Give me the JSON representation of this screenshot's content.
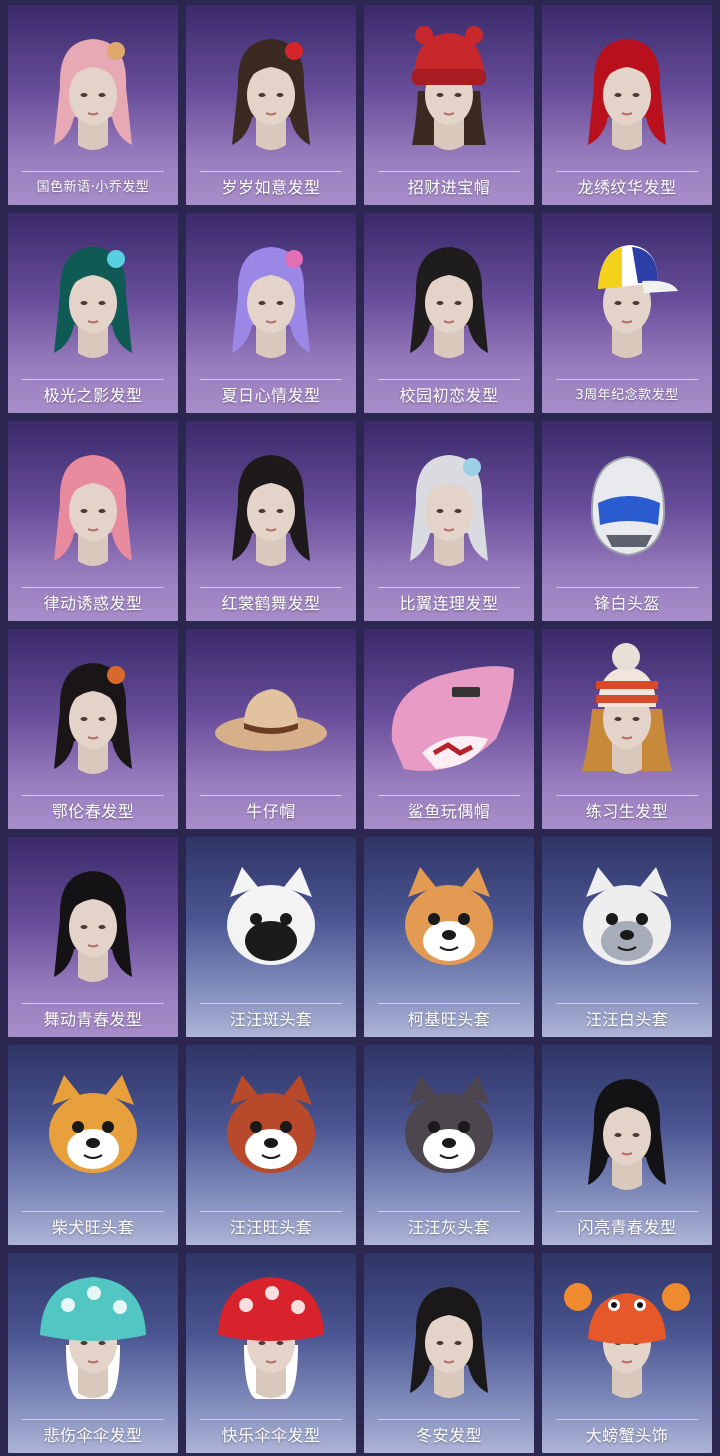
{
  "items": [
    {
      "label": "国色新语·小乔发型",
      "bg": "purple",
      "icon": "pink-braided-hair-icon",
      "kind": "hair",
      "hair": "#e7a9b3",
      "accent": "#e0a86a"
    },
    {
      "label": "岁岁如意发型",
      "bg": "purple",
      "icon": "twin-tail-hair-icon",
      "kind": "hair",
      "hair": "#3a2a22",
      "accent": "#d2262b"
    },
    {
      "label": "招财进宝帽",
      "bg": "purple",
      "icon": "red-knit-hat-icon",
      "kind": "hat",
      "hair": "#3a2a22",
      "accent": "#c8272b"
    },
    {
      "label": "龙绣纹华发型",
      "bg": "purple",
      "icon": "red-bob-hair-icon",
      "kind": "hair",
      "hair": "#b8101c",
      "accent": "#b8101c"
    },
    {
      "label": "极光之影发型",
      "bg": "purple",
      "icon": "teal-twin-tail-hair-icon",
      "kind": "hair",
      "hair": "#0f5a55",
      "accent": "#58d0e0"
    },
    {
      "label": "夏日心情发型",
      "bg": "purple",
      "icon": "lavender-hair-icon",
      "kind": "hair",
      "hair": "#9b87e6",
      "accent": "#e26fb4"
    },
    {
      "label": "校园初恋发型",
      "bg": "purple",
      "icon": "black-long-hair-icon",
      "kind": "hair",
      "hair": "#1f1c1d",
      "accent": "#1f1c1d"
    },
    {
      "label": "3周年纪念款发型",
      "bg": "purple",
      "icon": "baseball-cap-icon",
      "kind": "cap",
      "hair": "#2a2420",
      "accent": "#f4d21b"
    },
    {
      "label": "律动诱惑发型",
      "bg": "purple",
      "icon": "pink-ponytail-hair-icon",
      "kind": "hair",
      "hair": "#e98b9e",
      "accent": "#e98b9e"
    },
    {
      "label": "红裳鹤舞发型",
      "bg": "purple",
      "icon": "double-bun-hair-icon",
      "kind": "hair",
      "hair": "#1e1a1c",
      "accent": "#1e1a1c"
    },
    {
      "label": "比翼连理发型",
      "bg": "purple",
      "icon": "silver-feather-hair-icon",
      "kind": "hair",
      "hair": "#d9dbe1",
      "accent": "#9dcfe7"
    },
    {
      "label": "锋白头盔",
      "bg": "purple",
      "icon": "motorcycle-helmet-icon",
      "kind": "helmet",
      "hair": "#e9eaee",
      "accent": "#2a5ccf"
    },
    {
      "label": "鄂伦春发型",
      "bg": "purple",
      "icon": "headband-braid-hair-icon",
      "kind": "hair",
      "hair": "#1a1516",
      "accent": "#d9692a"
    },
    {
      "label": "牛仔帽",
      "bg": "purple",
      "icon": "cowboy-hat-icon",
      "kind": "cowboy",
      "hair": "#d7b08a",
      "accent": "#6b3d22"
    },
    {
      "label": "鲨鱼玩偶帽",
      "bg": "purple",
      "icon": "shark-plush-hat-icon",
      "kind": "shark",
      "hair": "#e89bc4",
      "accent": "#b5222c"
    },
    {
      "label": "练习生发型",
      "bg": "purple",
      "icon": "knit-beanie-hair-icon",
      "kind": "beanie",
      "hair": "#c9893a",
      "accent": "#d64a2a"
    },
    {
      "label": "舞动青春发型",
      "bg": "purple",
      "icon": "black-bangs-hair-icon",
      "kind": "hair",
      "hair": "#141214",
      "accent": "#141214"
    },
    {
      "label": "汪汪斑头套",
      "bg": "blue",
      "icon": "dalmatian-mask-icon",
      "kind": "dog",
      "hair": "#f3f3f3",
      "accent": "#1b1b1b"
    },
    {
      "label": "柯基旺头套",
      "bg": "blue",
      "icon": "corgi-mask-icon",
      "kind": "dog",
      "hair": "#e39a52",
      "accent": "#ffffff"
    },
    {
      "label": "汪汪白头套",
      "bg": "blue",
      "icon": "white-dog-mask-icon",
      "kind": "dog",
      "hair": "#eeeeee",
      "accent": "#a7adb8"
    },
    {
      "label": "柴犬旺头套",
      "bg": "blue",
      "icon": "shiba-mask-icon",
      "kind": "dog",
      "hair": "#e8a03d",
      "accent": "#ffffff"
    },
    {
      "label": "汪汪旺头套",
      "bg": "blue",
      "icon": "red-dog-mask-icon",
      "kind": "dog",
      "hair": "#b8492a",
      "accent": "#ffffff"
    },
    {
      "label": "汪汪灰头套",
      "bg": "blue",
      "icon": "gray-dog-mask-icon",
      "kind": "dog",
      "hair": "#4d464e",
      "accent": "#ffffff"
    },
    {
      "label": "闪亮青春发型",
      "bg": "blue",
      "icon": "short-black-hair-icon",
      "kind": "hair",
      "hair": "#131214",
      "accent": "#131214"
    },
    {
      "label": "悲伤伞伞发型",
      "bg": "blue",
      "icon": "teal-mushroom-hat-icon",
      "kind": "mushroom",
      "hair": "#52c6c2",
      "accent": "#ffffff"
    },
    {
      "label": "快乐伞伞发型",
      "bg": "blue",
      "icon": "red-mushroom-hat-icon",
      "kind": "mushroom",
      "hair": "#d8232c",
      "accent": "#ffffff"
    },
    {
      "label": "冬安发型",
      "bg": "blue",
      "icon": "low-braid-hair-icon",
      "kind": "hair",
      "hair": "#1a1819",
      "accent": "#1a1819"
    },
    {
      "label": "大螃蟹头饰",
      "bg": "blue",
      "icon": "crab-headpiece-icon",
      "kind": "crab",
      "hair": "#e6572a",
      "accent": "#f08a2e"
    }
  ]
}
